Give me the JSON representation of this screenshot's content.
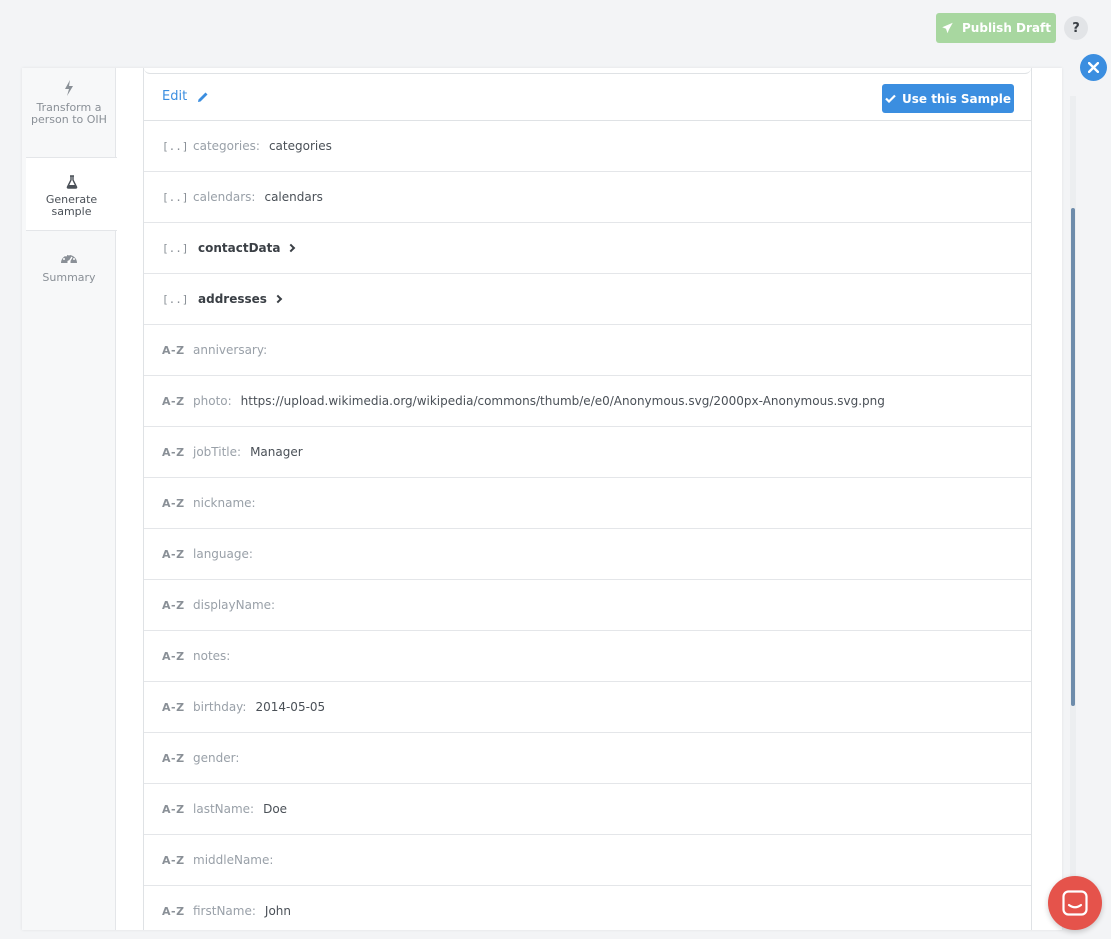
{
  "topbar": {
    "publish_label": "Publish Draft",
    "help_label": "?"
  },
  "steps": [
    {
      "label": "Transform a person to OIH",
      "icon": "bolt-icon"
    },
    {
      "label": "Generate sample",
      "icon": "flask-icon"
    },
    {
      "label": "Summary",
      "icon": "dashboard-icon"
    }
  ],
  "sample": {
    "edit_label": "Edit",
    "use_label": "Use this Sample",
    "rows": [
      {
        "type": "[..]",
        "key": "categories:",
        "value": "categories"
      },
      {
        "type": "[..]",
        "key": "calendars:",
        "value": "calendars"
      },
      {
        "type": "[..]",
        "key": "contactData",
        "value": ""
      },
      {
        "type": "[..]",
        "key": "addresses",
        "value": ""
      },
      {
        "type": "A-Z",
        "key": "anniversary:",
        "value": ""
      },
      {
        "type": "A-Z",
        "key": "photo:",
        "value": "https://upload.wikimedia.org/wikipedia/commons/thumb/e/e0/Anonymous.svg/2000px-Anonymous.svg.png"
      },
      {
        "type": "A-Z",
        "key": "jobTitle:",
        "value": "Manager"
      },
      {
        "type": "A-Z",
        "key": "nickname:",
        "value": ""
      },
      {
        "type": "A-Z",
        "key": "language:",
        "value": ""
      },
      {
        "type": "A-Z",
        "key": "displayName:",
        "value": ""
      },
      {
        "type": "A-Z",
        "key": "notes:",
        "value": ""
      },
      {
        "type": "A-Z",
        "key": "birthday:",
        "value": "2014-05-05"
      },
      {
        "type": "A-Z",
        "key": "gender:",
        "value": ""
      },
      {
        "type": "A-Z",
        "key": "lastName:",
        "value": "Doe"
      },
      {
        "type": "A-Z",
        "key": "middleName:",
        "value": ""
      },
      {
        "type": "A-Z",
        "key": "firstName:",
        "value": "John"
      }
    ]
  },
  "colors": {
    "accent": "#3b8ee0",
    "publish": "#a8d7a0",
    "chat": "#e5534b"
  }
}
